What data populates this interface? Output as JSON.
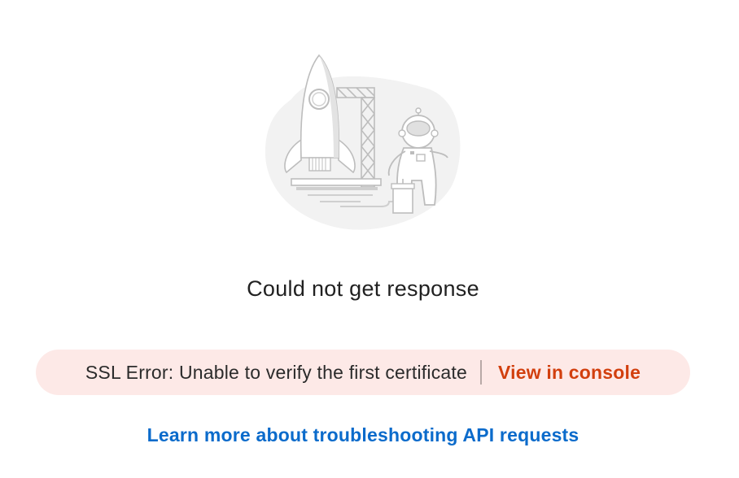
{
  "empty_state": {
    "illustration": "rocket-launch-astronaut-illustration",
    "title": "Could not get response"
  },
  "error": {
    "message": "SSL Error: Unable to verify the first certificate",
    "action_label": "View in console",
    "colors": {
      "banner_background": "#fde9e7",
      "action": "#d23f0e"
    }
  },
  "help": {
    "link_label": "Learn more about troubleshooting API requests",
    "color": "#0b6bcb"
  }
}
